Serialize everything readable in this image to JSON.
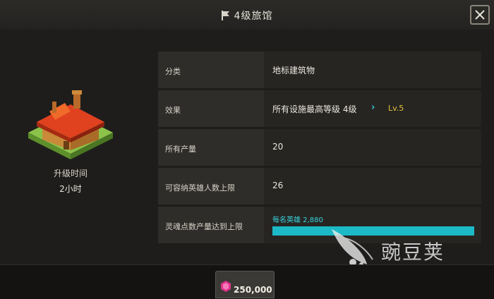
{
  "header": {
    "title": "4级旅馆",
    "flag_icon": "flag-icon",
    "close_icon": "close-icon"
  },
  "building": {
    "icon": "inn-building-icon",
    "upgrade_time_label": "升级时间",
    "upgrade_time_value": "2小时"
  },
  "rows": [
    {
      "label": "分类",
      "value": "地标建筑物"
    },
    {
      "label": "效果",
      "value": "所有设施最高等级  4级",
      "next_level": "Lv.5",
      "chevron_icon": "chevron-right-icon"
    },
    {
      "label": "所有产量",
      "value": "20"
    },
    {
      "label": "可容纳英雄人数上限",
      "value": "26"
    },
    {
      "label": "灵魂点数产量达到上限",
      "bar_label": "每名英雄  2,880",
      "bar_fill": 1.0
    }
  ],
  "cost": {
    "icon": "pink-gem-icon",
    "value": "250,000"
  },
  "watermark": {
    "text": "豌豆荚",
    "icon": "wandoujia-logo-icon"
  },
  "colors": {
    "accent": "#1cb9c6",
    "level": "#e5c43a",
    "gem": "#e0338c"
  }
}
